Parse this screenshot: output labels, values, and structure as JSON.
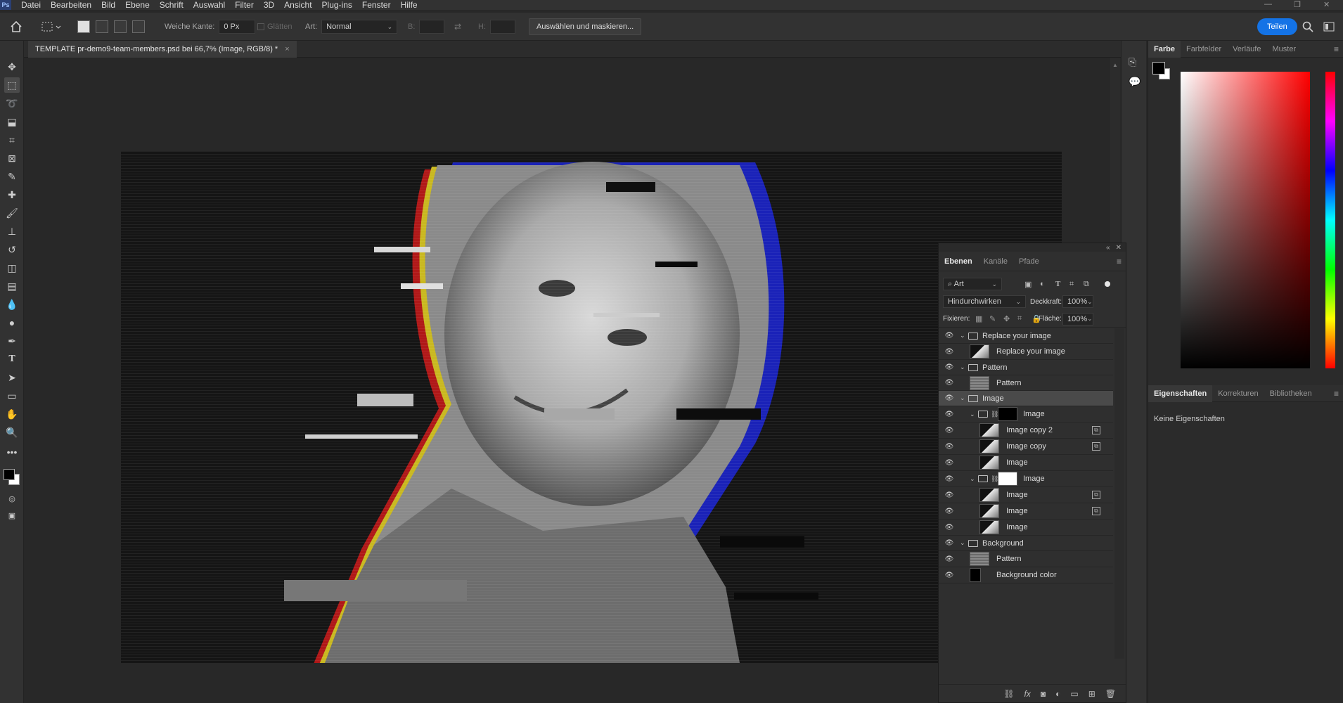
{
  "app": {
    "logo": "Ps",
    "menu": [
      "Datei",
      "Bearbeiten",
      "Bild",
      "Ebene",
      "Schrift",
      "Auswahl",
      "Filter",
      "3D",
      "Ansicht",
      "Plug-ins",
      "Fenster",
      "Hilfe"
    ]
  },
  "options": {
    "feather_label": "Weiche Kante:",
    "feather_value": "0 Px",
    "antialias_label": "Glätten",
    "style_label": "Art:",
    "style_value": "Normal",
    "width_label": "B:",
    "height_label": "H:",
    "select_mask_label": "Auswählen und maskieren...",
    "share_label": "Teilen"
  },
  "document": {
    "tab_title": "TEMPLATE pr-demo9-team-members.psd bei 66,7% (Image, RGB/8) *",
    "close_glyph": "×"
  },
  "color_panel": {
    "tabs": [
      "Farbe",
      "Farbfelder",
      "Verläufe",
      "Muster"
    ],
    "active_tab": "Farbe",
    "foreground": "#000000",
    "background": "#ffffff",
    "hue": "#ff0000"
  },
  "properties_panel": {
    "tabs": [
      "Eigenschaften",
      "Korrekturen",
      "Bibliotheken"
    ],
    "active_tab": "Eigenschaften",
    "empty_text": "Keine Eigenschaften"
  },
  "layers_panel": {
    "tabs": [
      "Ebenen",
      "Kanäle",
      "Pfade"
    ],
    "active_tab": "Ebenen",
    "filter_value": "Art",
    "blend_mode": "Hindurchwirken",
    "opacity_label": "Deckkraft:",
    "opacity_value": "100%",
    "lock_label": "Fixieren:",
    "fill_label": "Fläche:",
    "fill_value": "100%",
    "layers": [
      {
        "name": "Replace your image",
        "kind": "group",
        "indent": 0,
        "selected": false
      },
      {
        "name": "Replace your image",
        "kind": "smart",
        "indent": 1,
        "selected": false
      },
      {
        "name": "Pattern",
        "kind": "group",
        "indent": 0,
        "selected": false
      },
      {
        "name": "Pattern",
        "kind": "pattern",
        "indent": 1,
        "selected": false
      },
      {
        "name": "Image",
        "kind": "group",
        "indent": 0,
        "selected": true
      },
      {
        "name": "Image",
        "kind": "masked-group-dark",
        "indent": 1,
        "selected": false
      },
      {
        "name": "Image copy 2",
        "kind": "smart-linked",
        "indent": 2,
        "selected": false
      },
      {
        "name": "Image copy",
        "kind": "smart-linked",
        "indent": 2,
        "selected": false
      },
      {
        "name": "Image",
        "kind": "smart",
        "indent": 2,
        "selected": false
      },
      {
        "name": "Image",
        "kind": "masked-group-light",
        "indent": 1,
        "selected": false
      },
      {
        "name": "Image",
        "kind": "smart-linked",
        "indent": 2,
        "selected": false
      },
      {
        "name": "Image",
        "kind": "smart-linked",
        "indent": 2,
        "selected": false
      },
      {
        "name": "Image",
        "kind": "smart",
        "indent": 2,
        "selected": false
      },
      {
        "name": "Background",
        "kind": "group",
        "indent": 0,
        "selected": false
      },
      {
        "name": "Pattern",
        "kind": "pattern",
        "indent": 1,
        "selected": false
      },
      {
        "name": "Background color",
        "kind": "fill-black",
        "indent": 1,
        "selected": false
      }
    ]
  }
}
